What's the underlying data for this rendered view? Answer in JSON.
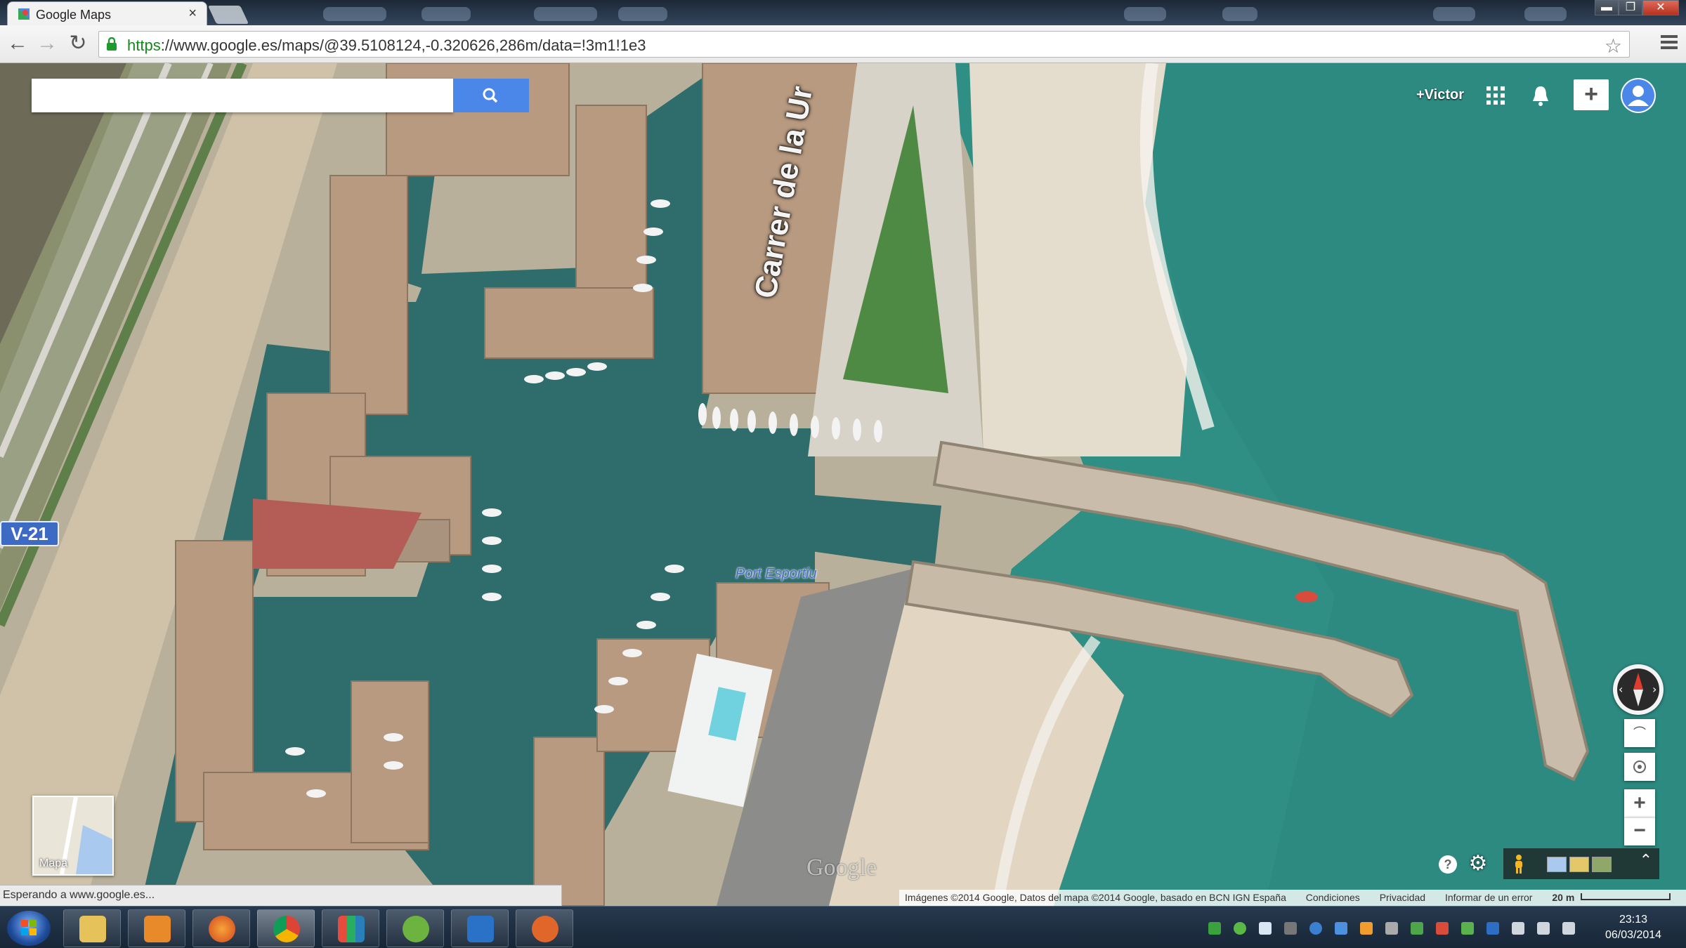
{
  "browser": {
    "tab_title": "Google Maps",
    "tab_close": "×",
    "url_scheme": "https",
    "url_rest": "://www.google.es/maps/@39.5108124,-0.320626,286m/data=!3m1!1e3",
    "back_label": "←",
    "forward_label": "→",
    "reload_label": "↻",
    "star_label": "☆",
    "window_controls": [
      "▬",
      "❐",
      "✕"
    ]
  },
  "maps": {
    "search_placeholder": "",
    "account_name": "+Victor",
    "share_label": "+",
    "street_label": "Carrer de la Ur",
    "port_label": "Port Esportiu",
    "road_badge": "V-21",
    "minimap_label": "Mapa",
    "google_logo": "Google",
    "help_label": "?",
    "settings_glyph": "⚙",
    "tilt_label": "⌒",
    "zoom_in_label": "+",
    "zoom_out_label": "−",
    "layer_expand": "⌃",
    "attribution": {
      "imagery": "Imágenes ©2014 Google, Datos del mapa ©2014 Google, basado en BCN IGN España",
      "terms": "Condiciones",
      "privacy": "Privacidad",
      "report": "Informar de un error",
      "scale": "20 m"
    }
  },
  "status_text": "Esperando a www.google.es...",
  "taskbar": {
    "apps": [
      "file-explorer",
      "media-player",
      "firefox",
      "chrome",
      "metro-apps",
      "utorrent",
      "outlook",
      "hand-app"
    ],
    "time": "23:13",
    "date": "06/03/2014"
  },
  "colors": {
    "search_blue": "#4b87e9",
    "sea": "#2f8f84",
    "harbor_water": "#2e6d6b",
    "sand": "#e4dccd",
    "url_green": "#128b1c"
  }
}
